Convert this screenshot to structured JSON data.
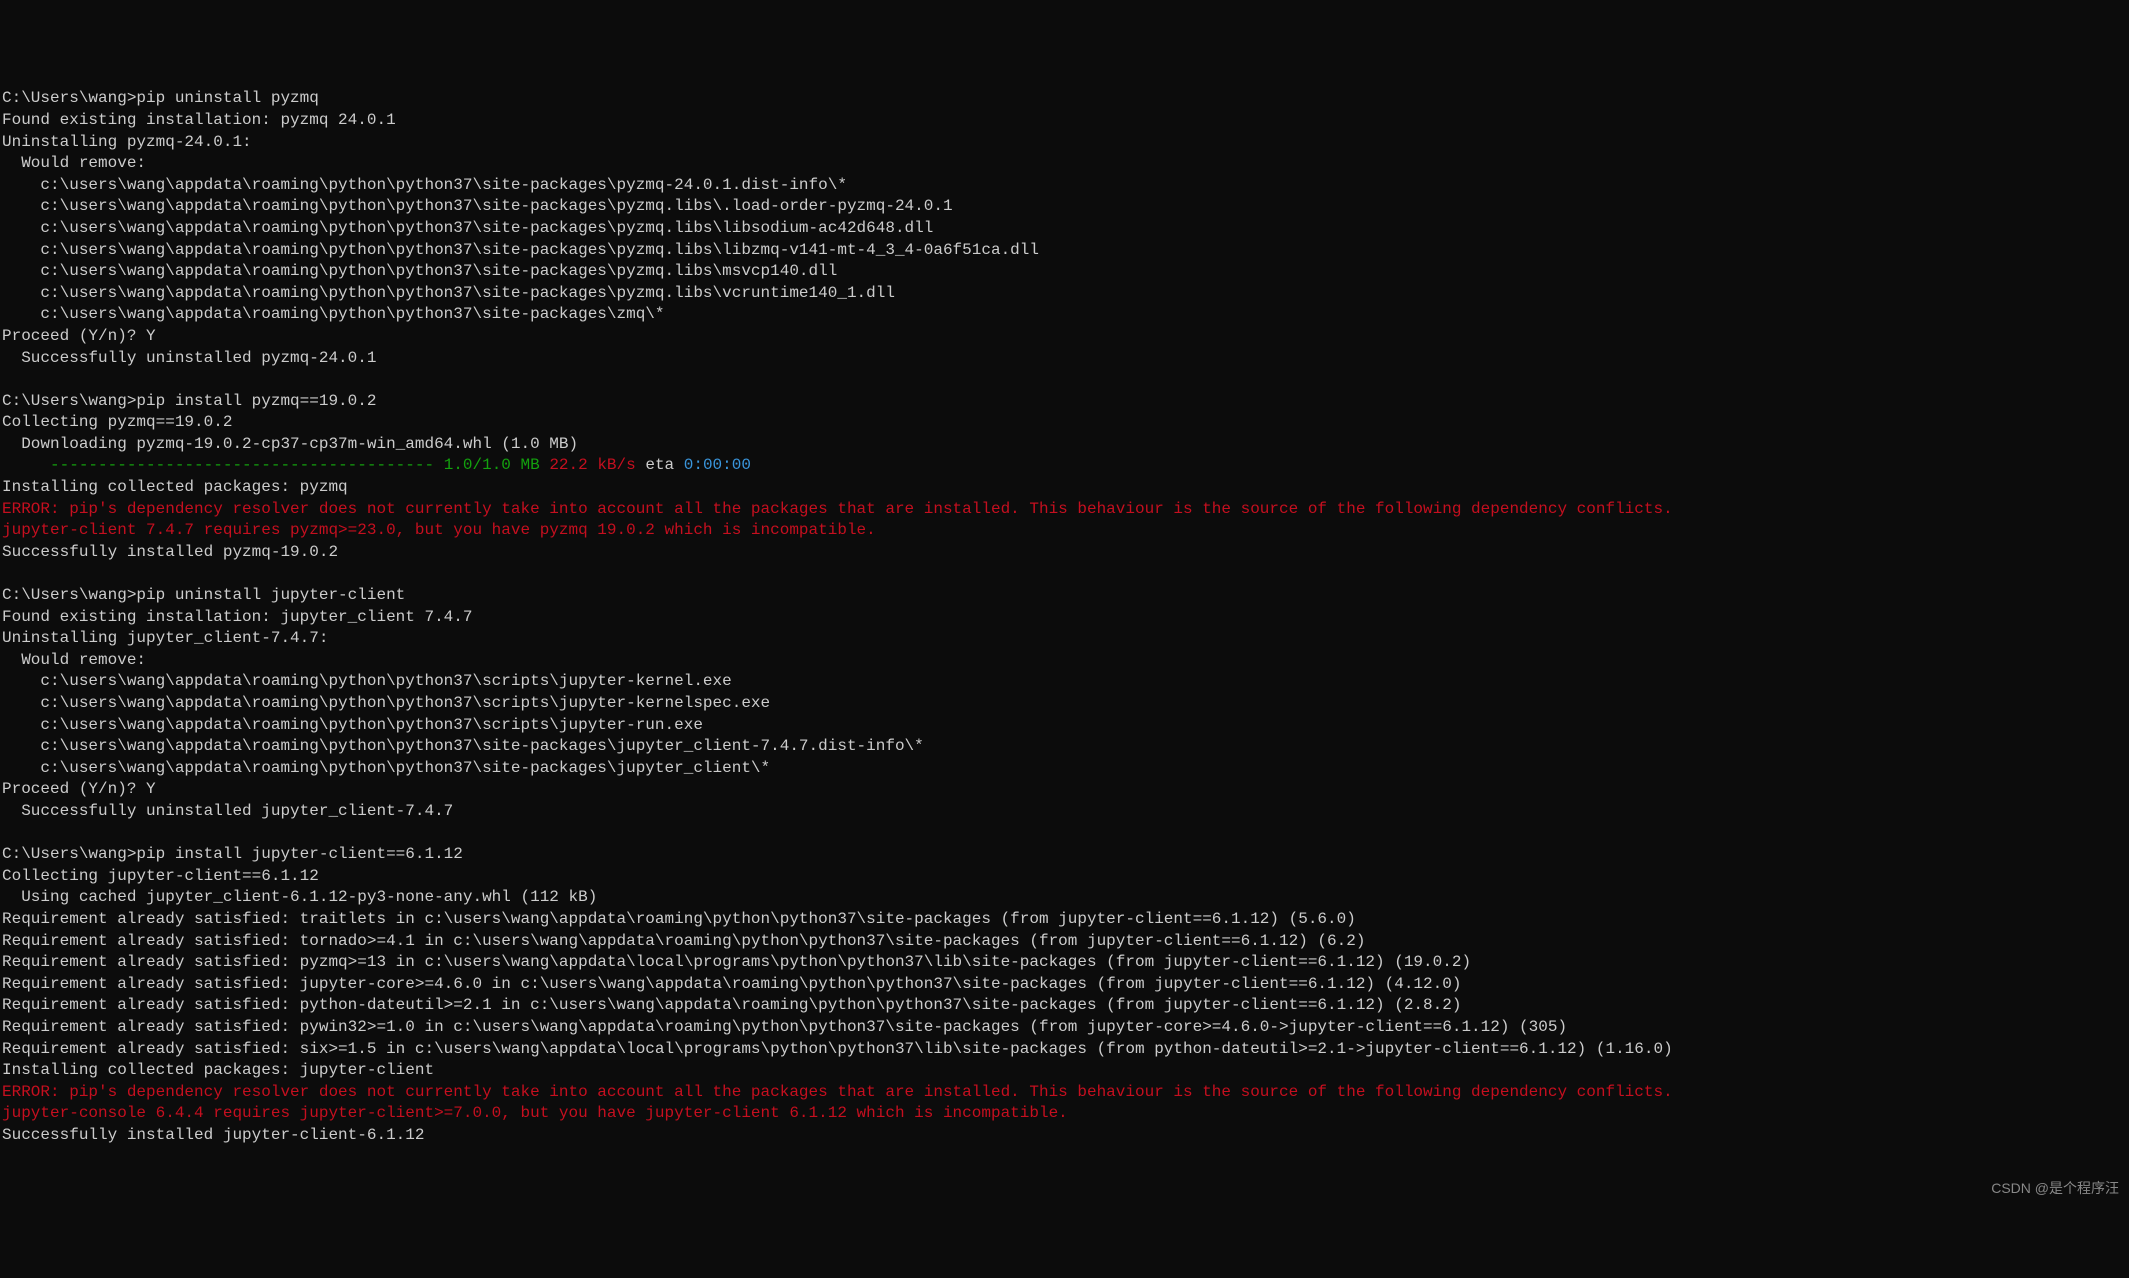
{
  "lines": [
    {
      "t": "C:\\Users\\wang>pip uninstall pyzmq"
    },
    {
      "t": "Found existing installation: pyzmq 24.0.1"
    },
    {
      "t": "Uninstalling pyzmq-24.0.1:"
    },
    {
      "t": "  Would remove:"
    },
    {
      "t": "    c:\\users\\wang\\appdata\\roaming\\python\\python37\\site-packages\\pyzmq-24.0.1.dist-info\\*"
    },
    {
      "t": "    c:\\users\\wang\\appdata\\roaming\\python\\python37\\site-packages\\pyzmq.libs\\.load-order-pyzmq-24.0.1"
    },
    {
      "t": "    c:\\users\\wang\\appdata\\roaming\\python\\python37\\site-packages\\pyzmq.libs\\libsodium-ac42d648.dll"
    },
    {
      "t": "    c:\\users\\wang\\appdata\\roaming\\python\\python37\\site-packages\\pyzmq.libs\\libzmq-v141-mt-4_3_4-0a6f51ca.dll"
    },
    {
      "t": "    c:\\users\\wang\\appdata\\roaming\\python\\python37\\site-packages\\pyzmq.libs\\msvcp140.dll"
    },
    {
      "t": "    c:\\users\\wang\\appdata\\roaming\\python\\python37\\site-packages\\pyzmq.libs\\vcruntime140_1.dll"
    },
    {
      "t": "    c:\\users\\wang\\appdata\\roaming\\python\\python37\\site-packages\\zmq\\*"
    },
    {
      "t": "Proceed (Y/n)? Y"
    },
    {
      "t": "  Successfully uninstalled pyzmq-24.0.1"
    },
    {
      "t": ""
    },
    {
      "t": "C:\\Users\\wang>pip install pyzmq==19.0.2"
    },
    {
      "t": "Collecting pyzmq==19.0.2"
    },
    {
      "t": "  Downloading pyzmq-19.0.2-cp37-cp37m-win_amd64.whl (1.0 MB)"
    },
    {
      "segments": [
        {
          "t": "     ",
          "cls": ""
        },
        {
          "t": "---------------------------------------- ",
          "cls": "green"
        },
        {
          "t": "1.0/1.0 MB",
          "cls": "green"
        },
        {
          "t": " ",
          "cls": ""
        },
        {
          "t": "22.2 kB/s",
          "cls": "red"
        },
        {
          "t": " eta ",
          "cls": ""
        },
        {
          "t": "0:00:00",
          "cls": "cyan"
        }
      ]
    },
    {
      "t": "Installing collected packages: pyzmq"
    },
    {
      "t": "ERROR: pip's dependency resolver does not currently take into account all the packages that are installed. This behaviour is the source of the following dependency conflicts.",
      "cls": "red"
    },
    {
      "t": "jupyter-client 7.4.7 requires pyzmq>=23.0, but you have pyzmq 19.0.2 which is incompatible.",
      "cls": "red"
    },
    {
      "t": "Successfully installed pyzmq-19.0.2"
    },
    {
      "t": ""
    },
    {
      "t": "C:\\Users\\wang>pip uninstall jupyter-client"
    },
    {
      "t": "Found existing installation: jupyter_client 7.4.7"
    },
    {
      "t": "Uninstalling jupyter_client-7.4.7:"
    },
    {
      "t": "  Would remove:"
    },
    {
      "t": "    c:\\users\\wang\\appdata\\roaming\\python\\python37\\scripts\\jupyter-kernel.exe"
    },
    {
      "t": "    c:\\users\\wang\\appdata\\roaming\\python\\python37\\scripts\\jupyter-kernelspec.exe"
    },
    {
      "t": "    c:\\users\\wang\\appdata\\roaming\\python\\python37\\scripts\\jupyter-run.exe"
    },
    {
      "t": "    c:\\users\\wang\\appdata\\roaming\\python\\python37\\site-packages\\jupyter_client-7.4.7.dist-info\\*"
    },
    {
      "t": "    c:\\users\\wang\\appdata\\roaming\\python\\python37\\site-packages\\jupyter_client\\*"
    },
    {
      "t": "Proceed (Y/n)? Y"
    },
    {
      "t": "  Successfully uninstalled jupyter_client-7.4.7"
    },
    {
      "t": ""
    },
    {
      "t": "C:\\Users\\wang>pip install jupyter-client==6.1.12"
    },
    {
      "t": "Collecting jupyter-client==6.1.12"
    },
    {
      "t": "  Using cached jupyter_client-6.1.12-py3-none-any.whl (112 kB)"
    },
    {
      "t": "Requirement already satisfied: traitlets in c:\\users\\wang\\appdata\\roaming\\python\\python37\\site-packages (from jupyter-client==6.1.12) (5.6.0)"
    },
    {
      "t": "Requirement already satisfied: tornado>=4.1 in c:\\users\\wang\\appdata\\roaming\\python\\python37\\site-packages (from jupyter-client==6.1.12) (6.2)"
    },
    {
      "t": "Requirement already satisfied: pyzmq>=13 in c:\\users\\wang\\appdata\\local\\programs\\python\\python37\\lib\\site-packages (from jupyter-client==6.1.12) (19.0.2)"
    },
    {
      "t": "Requirement already satisfied: jupyter-core>=4.6.0 in c:\\users\\wang\\appdata\\roaming\\python\\python37\\site-packages (from jupyter-client==6.1.12) (4.12.0)"
    },
    {
      "t": "Requirement already satisfied: python-dateutil>=2.1 in c:\\users\\wang\\appdata\\roaming\\python\\python37\\site-packages (from jupyter-client==6.1.12) (2.8.2)"
    },
    {
      "t": "Requirement already satisfied: pywin32>=1.0 in c:\\users\\wang\\appdata\\roaming\\python\\python37\\site-packages (from jupyter-core>=4.6.0->jupyter-client==6.1.12) (305)"
    },
    {
      "t": "Requirement already satisfied: six>=1.5 in c:\\users\\wang\\appdata\\local\\programs\\python\\python37\\lib\\site-packages (from python-dateutil>=2.1->jupyter-client==6.1.12) (1.16.0)"
    },
    {
      "t": "Installing collected packages: jupyter-client"
    },
    {
      "t": "ERROR: pip's dependency resolver does not currently take into account all the packages that are installed. This behaviour is the source of the following dependency conflicts.",
      "cls": "red"
    },
    {
      "t": "jupyter-console 6.4.4 requires jupyter-client>=7.0.0, but you have jupyter-client 6.1.12 which is incompatible.",
      "cls": "red"
    },
    {
      "t": "Successfully installed jupyter-client-6.1.12"
    }
  ],
  "watermark": "CSDN @是个程序汪"
}
